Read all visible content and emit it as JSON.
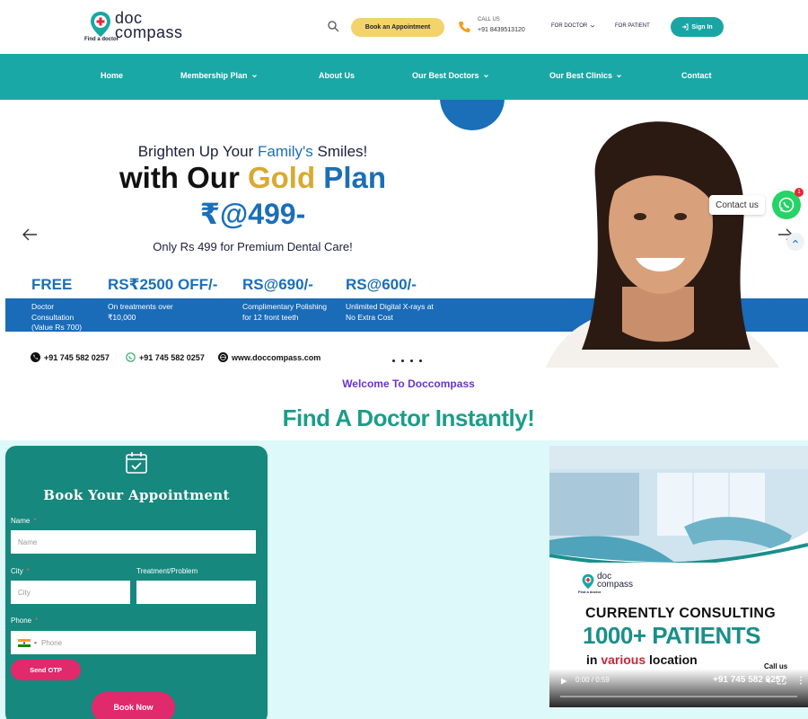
{
  "header": {
    "logo": {
      "line1": "doc",
      "line2": "compass",
      "tagline": "Find a doctor"
    },
    "book_appointment": "Book an Appointment",
    "call_us_label": "CALL US",
    "call_us_number": "+91 8439513120",
    "for_doctor": "FOR DOCTOR",
    "for_patient": "FOR PATIENT",
    "sign_in": "Sign In"
  },
  "nav": {
    "home": "Home",
    "membership": "Membership Plan",
    "about": "About Us",
    "doctors": "Our Best Doctors",
    "clinics": "Our Best Clinics",
    "contact": "Contact"
  },
  "hero": {
    "line1_a": "Brighten Up Your ",
    "line1_b": "Family's",
    "line1_c": " Smiles!",
    "line2_a": "with Our ",
    "line2_b": "Gold",
    "line2_c": " Plan",
    "price": "₹@499-",
    "sub": "Only Rs 499 for Premium Dental Care!",
    "offers": [
      {
        "big": "FREE",
        "small": "Doctor Consultation (Value Rs 700)"
      },
      {
        "big": "RS₹2500 OFF/-",
        "small": "On treatments over ₹10,000"
      },
      {
        "big": "RS@690/-",
        "small": "Complimentary Polishing for 12 front teeth"
      },
      {
        "big": "RS@600/-",
        "small": "Unlimited Digital X-rays at No Extra Cost"
      }
    ],
    "phone1": "+91 745 582 0257",
    "phone2": "+91 745 582 0257",
    "website": "www.doccompass.com",
    "contact_us_bubble": "Contact us",
    "wa_badge": "1"
  },
  "welcome": "Welcome To Doccompass",
  "find_title": "Find A Doctor Instantly!",
  "form": {
    "title": "Book Your Appointment",
    "name_label": "Name",
    "name_placeholder": "Name",
    "city_label": "City",
    "city_placeholder": "City",
    "treatment_label": "Treatment/Problem",
    "phone_label": "Phone",
    "phone_placeholder": "Phone",
    "send_otp": "Send OTP",
    "book_now": "Book Now",
    "required_mark": "*"
  },
  "video": {
    "logo_line1": "doc",
    "logo_line2": "compass",
    "logo_tag": "Find a doctor",
    "line1": "CURRENTLY CONSULTING",
    "line2": "1000+ PATIENTS",
    "line3_a": "in ",
    "line3_b": "various",
    "line3_c": " location",
    "call_us": "Call us",
    "number": "+91 745 582 0257",
    "time": "0:00 / 0:59"
  }
}
